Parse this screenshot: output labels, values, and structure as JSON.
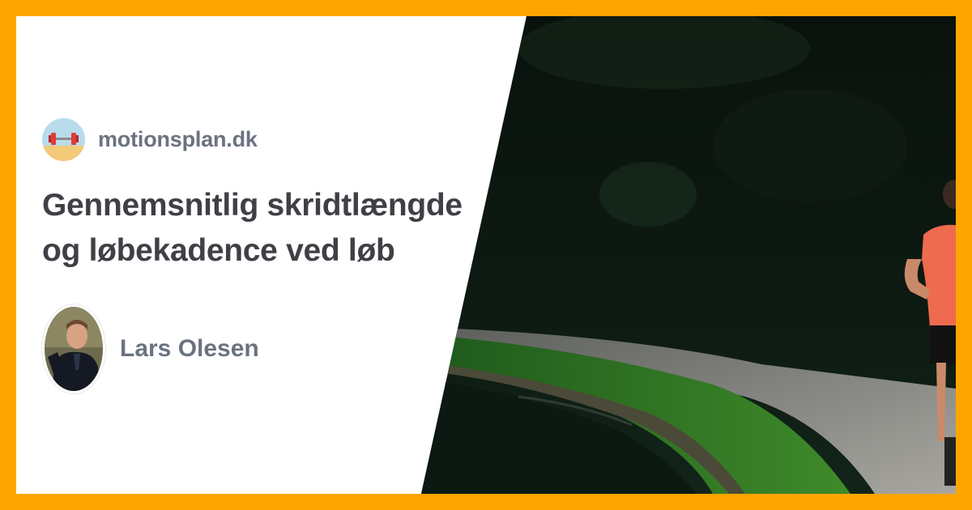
{
  "site": {
    "name": "motionsplan.dk",
    "logo_icon": "dumbbell-icon"
  },
  "article": {
    "title": "Gennemsnitlig skridtlængde og løbekadence ved løb"
  },
  "author": {
    "name": "Lars Olesen",
    "avatar_icon": "author-portrait"
  },
  "colors": {
    "frame_border": "#FFA500",
    "card_background": "#FFFFFF",
    "title_text": "#3F3F46",
    "muted_text": "#6B7280"
  }
}
